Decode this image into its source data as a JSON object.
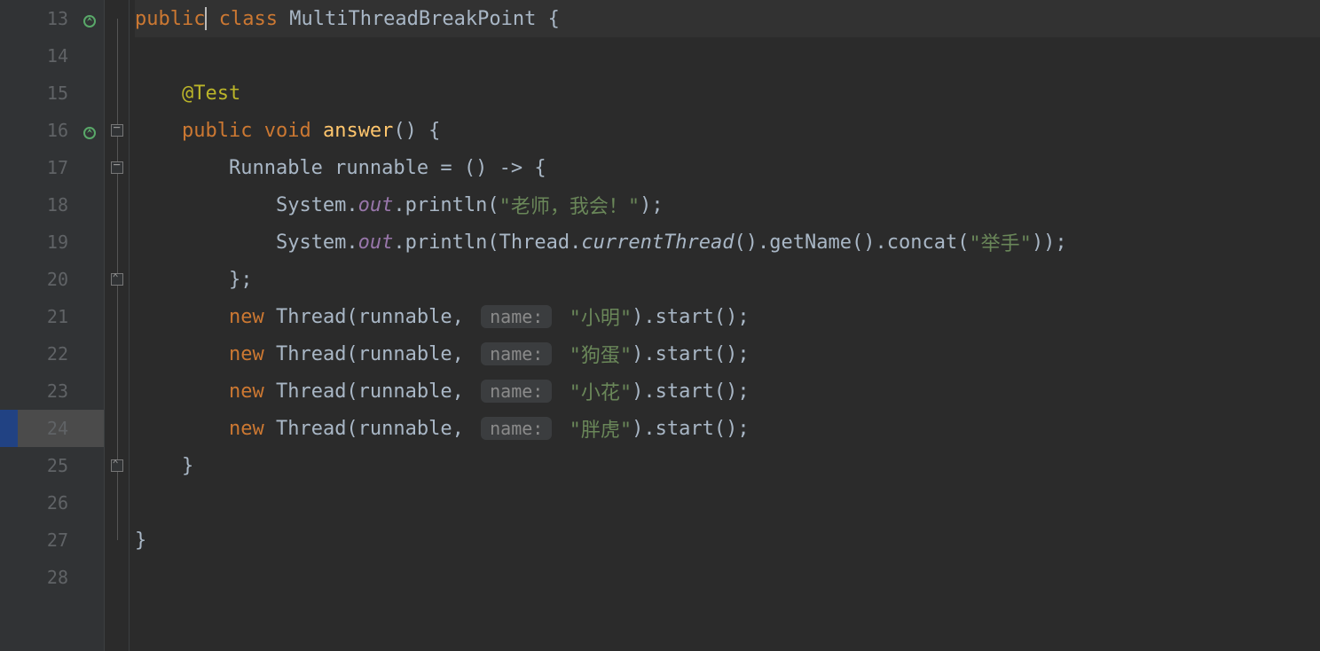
{
  "lines": {
    "start": 13,
    "end": 28,
    "nums": [
      "13",
      "14",
      "15",
      "16",
      "17",
      "18",
      "19",
      "20",
      "21",
      "22",
      "23",
      "24",
      "25",
      "26",
      "27",
      "28"
    ]
  },
  "code": {
    "l13": {
      "public": "public",
      "class": "class",
      "name": "MultiThreadBreakPoint",
      "brace": " {"
    },
    "l15": {
      "annot": "@Test"
    },
    "l16": {
      "public": "public",
      "void": "void",
      "method": "answer",
      "rest": "() {"
    },
    "l17": {
      "a": "Runnable runnable = () -> {"
    },
    "l18": {
      "sys": "System.",
      "out": "out",
      "dot": ".println(",
      "str": "\"老师，我会！\"",
      "end": ");"
    },
    "l19": {
      "sys": "System.",
      "out": "out",
      "dot": ".println(Thread.",
      "cur": "currentThread",
      "mid": "().getName().concat(",
      "str": "\"举手\"",
      "end": "));"
    },
    "l20": {
      "a": "};"
    },
    "l21": {
      "new": "new",
      "mid": " Thread(runnable, ",
      "hint": "name:",
      "str": "\"小明\"",
      "end": ").start();"
    },
    "l22": {
      "new": "new",
      "mid": " Thread(runnable, ",
      "hint": "name:",
      "str": "\"狗蛋\"",
      "end": ").start();"
    },
    "l23": {
      "new": "new",
      "mid": " Thread(runnable, ",
      "hint": "name:",
      "str": "\"小花\"",
      "end": ").start();"
    },
    "l24": {
      "new": "new",
      "mid": " Thread(runnable, ",
      "hint": "name:",
      "str": "\"胖虎\"",
      "end": ").start();"
    },
    "l25": {
      "a": "}"
    },
    "l27": {
      "a": "}"
    }
  },
  "hintLabel": "name:"
}
